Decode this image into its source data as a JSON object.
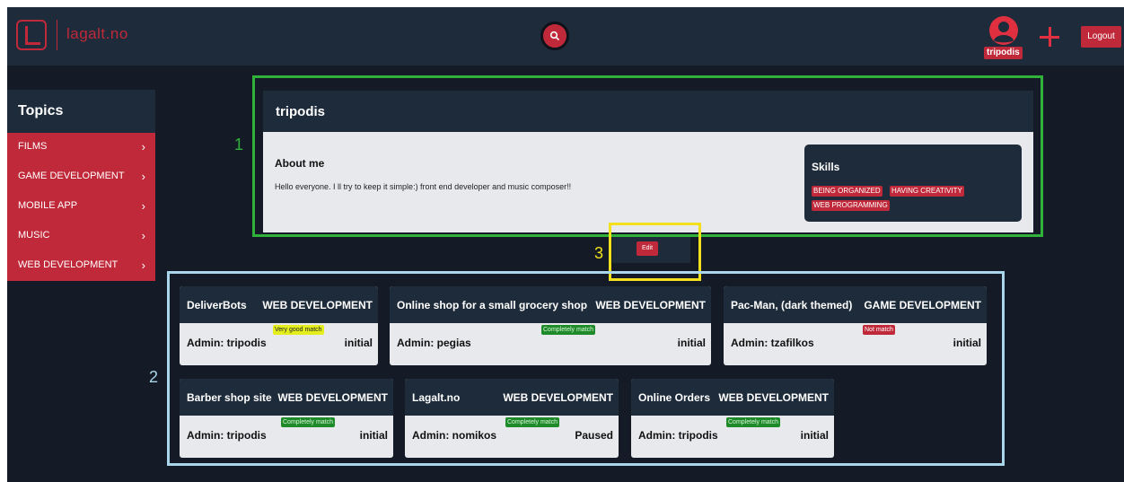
{
  "header": {
    "logo_text": "lagalt.no",
    "username_badge": "tripodis",
    "logout_label": "Logout"
  },
  "sidebar": {
    "title": "Topics",
    "items": [
      {
        "label": "FILMS"
      },
      {
        "label": "GAME DEVELOPMENT"
      },
      {
        "label": "MOBILE APP"
      },
      {
        "label": "MUSIC"
      },
      {
        "label": "WEB DEVELOPMENT"
      }
    ],
    "chevron": "›"
  },
  "profile": {
    "name": "tripodis",
    "about_title": "About me",
    "about_text": "Hello everyone. I ll try to keep it simple:) front end developer and music composer!!",
    "skills_title": "Skills",
    "skills": [
      "BEING ORGANIZED",
      "HAVING CREATIVITY",
      "WEB PROGRAMMING"
    ],
    "edit_label": "Edit"
  },
  "annotations": {
    "label_1": "1",
    "label_2": "2",
    "label_3": "3",
    "colors": {
      "green": "#2fb13a",
      "blue": "#a9d6ea",
      "yellow": "#f3e01c"
    }
  },
  "projects": [
    {
      "title": "DeliverBots",
      "category": "WEB DEVELOPMENT",
      "admin": "Admin: tripodis",
      "status": "initial",
      "match": "Very good match",
      "match_type": "very-good"
    },
    {
      "title": "Online shop for a small grocery shop",
      "category": "WEB DEVELOPMENT",
      "admin": "Admin: pegias",
      "status": "initial",
      "match": "Completely match",
      "match_type": "complete"
    },
    {
      "title": "Pac-Man, (dark themed)",
      "category": "GAME DEVELOPMENT",
      "admin": "Admin: tzafilkos",
      "status": "initial",
      "match": "Not match",
      "match_type": "not"
    },
    {
      "title": "Barber shop site",
      "category": "WEB DEVELOPMENT",
      "admin": "Admin: tripodis",
      "status": "initial",
      "match": "Completely match",
      "match_type": "complete"
    },
    {
      "title": "Lagalt.no",
      "category": "WEB DEVELOPMENT",
      "admin": "Admin: nomikos",
      "status": "Paused",
      "match": "Completely match",
      "match_type": "complete"
    },
    {
      "title": "Online Orders",
      "category": "WEB DEVELOPMENT",
      "admin": "Admin: tripodis",
      "status": "initial",
      "match": "Completely match",
      "match_type": "complete"
    }
  ],
  "colors": {
    "accent": "#c0293a",
    "dark_panel": "#1e2b3a",
    "background": "#151b26"
  }
}
